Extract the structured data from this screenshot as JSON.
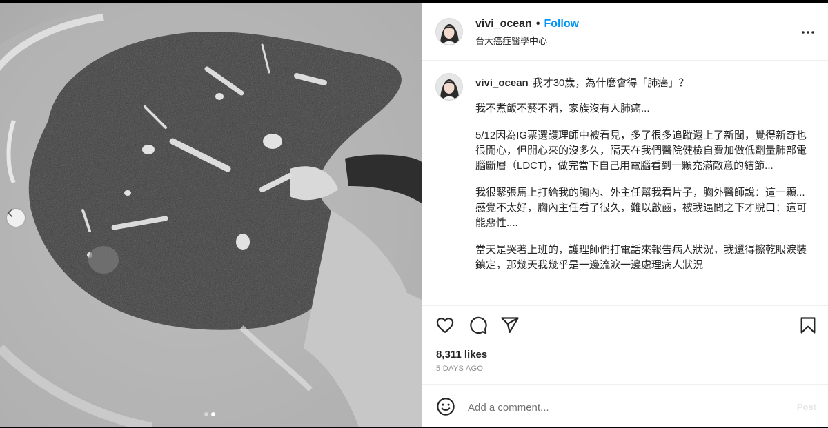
{
  "post": {
    "username": "vivi_ocean",
    "separator": "•",
    "follow_label": "Follow",
    "location": "台大癌症醫學中心",
    "more_icon": "more-horizontal-icon"
  },
  "caption": {
    "username": "vivi_ocean",
    "first_line": "我才30歲，為什麼會得「肺癌」？",
    "paragraphs": [
      "我不煮飯不菸不酒，家族沒有人肺癌...",
      "5/12因為IG票選護理師中被看見，多了很多追蹤還上了新聞，覺得新奇也很開心，但開心來的沒多久，隔天在我們醫院健檢自費加做低劑量肺部電腦斷層（LDCT)，做完當下自己用電腦看到一顆充滿敵意的結節...",
      "我很緊張馬上打給我的胸內、外主任幫我看片子，胸外醫師說：這一顆...感覺不太好，胸內主任看了很久，難以啟齒，被我逼問之下才脫口：這可能惡性....",
      "當天是哭著上班的，護理師們打電話來報告病人狀況，我還得擦乾眼淚裝鎮定，那幾天我幾乎是一邊流淚一邊處理病人狀況"
    ]
  },
  "actions": {
    "like_icon": "heart-icon",
    "comment_icon": "comment-icon",
    "share_icon": "share-icon",
    "save_icon": "bookmark-icon"
  },
  "stats": {
    "likes": "8,311 likes",
    "time": "5 DAYS AGO"
  },
  "comment": {
    "placeholder": "Add a comment...",
    "post_label": "Post",
    "emoji_icon": "emoji-icon"
  },
  "carousel": {
    "prev_icon": "chevron-left-icon",
    "slide_count": 2,
    "active_index": 1
  }
}
